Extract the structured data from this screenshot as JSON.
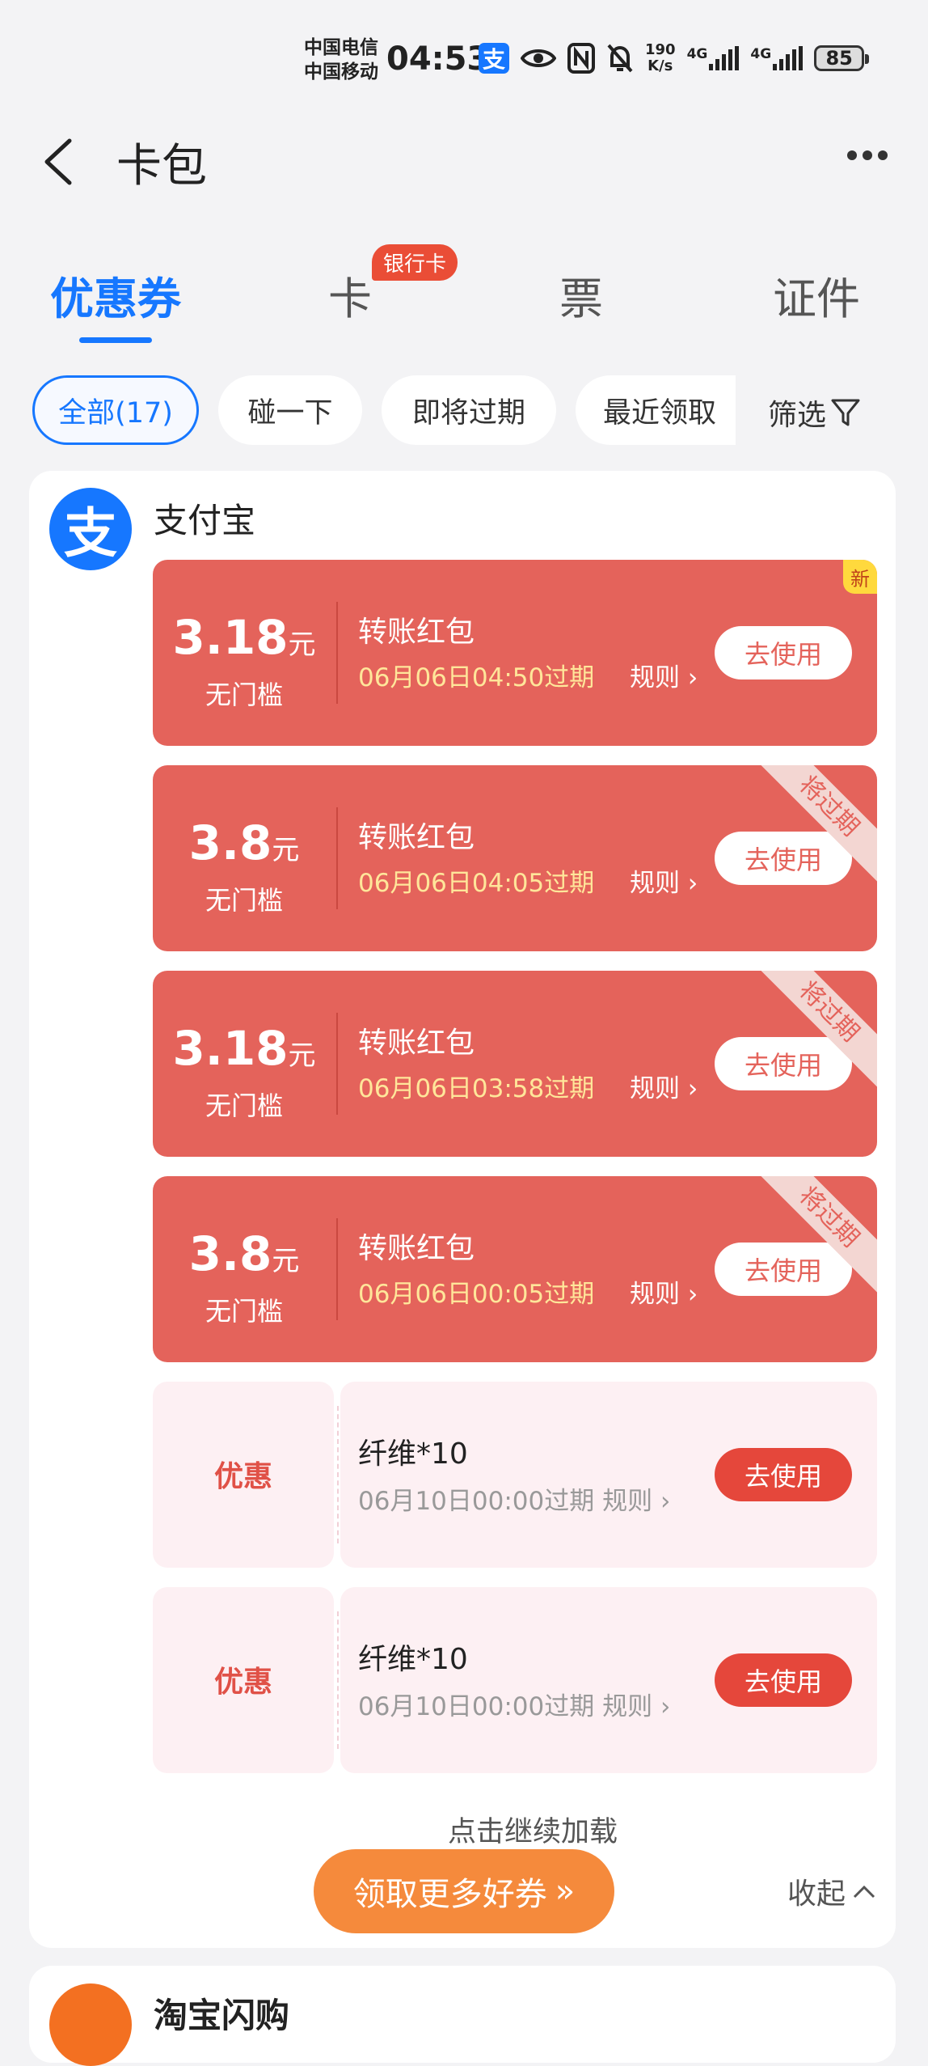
{
  "status_bar": {
    "carrier1": "中国电信",
    "carrier2": "中国移动",
    "time": "04:53",
    "net_speed_value": "190",
    "net_speed_unit": "K/s",
    "sig1": "4G",
    "sig2": "4G",
    "battery": "85"
  },
  "header": {
    "title": "卡包"
  },
  "tabs": [
    {
      "label": "优惠券",
      "active": true
    },
    {
      "label": "卡",
      "badge": "银行卡"
    },
    {
      "label": "票"
    },
    {
      "label": "证件"
    }
  ],
  "filters": {
    "chips": [
      "全部(17)",
      "碰一下",
      "即将过期",
      "最近领取"
    ],
    "filter_label": "筛选"
  },
  "merchant": {
    "logo_char": "支",
    "name": "支付宝"
  },
  "coupons_red": [
    {
      "amount": "3.18",
      "unit": "元",
      "threshold": "无门槛",
      "name": "转账红包",
      "expiry": "06月06日04:50过期",
      "rule": "规则",
      "button": "去使用",
      "tag": "新"
    },
    {
      "amount": "3.8",
      "unit": "元",
      "threshold": "无门槛",
      "name": "转账红包",
      "expiry": "06月06日04:05过期",
      "rule": "规则",
      "button": "去使用",
      "ribbon": "将过期"
    },
    {
      "amount": "3.18",
      "unit": "元",
      "threshold": "无门槛",
      "name": "转账红包",
      "expiry": "06月06日03:58过期",
      "rule": "规则",
      "button": "去使用",
      "ribbon": "将过期"
    },
    {
      "amount": "3.8",
      "unit": "元",
      "threshold": "无门槛",
      "name": "转账红包",
      "expiry": "06月06日00:05过期",
      "rule": "规则",
      "button": "去使用",
      "ribbon": "将过期"
    }
  ],
  "coupons_pink": [
    {
      "label": "优惠",
      "name": "纤维*10",
      "expiry": "06月10日00:00过期",
      "rule": "规则",
      "button": "去使用"
    },
    {
      "label": "优惠",
      "name": "纤维*10",
      "expiry": "06月10日00:00过期",
      "rule": "规则",
      "button": "去使用"
    }
  ],
  "footer": {
    "load_more": "点击继续加载",
    "get_more": "领取更多好券",
    "collapse": "收起"
  },
  "next_merchant": {
    "name": "淘宝闪购"
  },
  "colors": {
    "accent": "#1677ff",
    "coupon_red": "#e4635b",
    "coupon_pink": "#fdf0f3",
    "cta_orange": "#f58a3c"
  }
}
